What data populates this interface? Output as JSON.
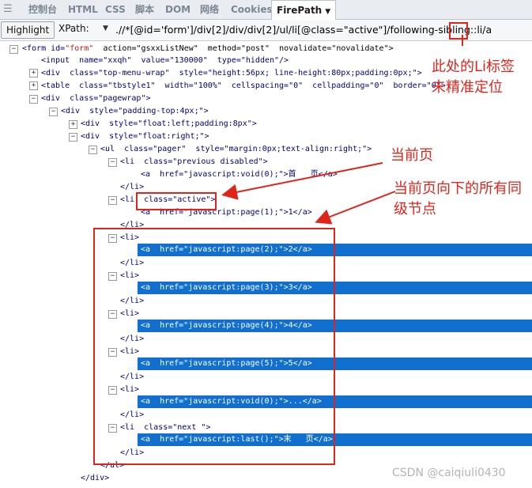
{
  "tabs": [
    {
      "label": "控制台"
    },
    {
      "label": "HTML"
    },
    {
      "label": "CSS"
    },
    {
      "label": "脚本"
    },
    {
      "label": "DOM"
    },
    {
      "label": "网络"
    },
    {
      "label": "Cookies"
    },
    {
      "label": "FirePath"
    }
  ],
  "toolbar": {
    "highlight_label": "Highlight",
    "xpath_label": "XPath:",
    "xpath_value": ".//*[@id='form']/div[2]/div/div[2]/ul/li[@class=\"active\"]/following-sibling::li/a"
  },
  "code_lines": [
    {
      "t": "<form ",
      "a": "id=",
      "v": "\"form\"",
      "rest": "  action=\"gsxxListNew\"  method=\"post\"  novalidate=\"novalidate\">"
    },
    {
      "t": "<input ",
      "rest": " name=\"xxqh\"  value=\"130000\"  type=\"hidden\"/>"
    },
    {
      "t": "<div ",
      "rest": " class=\"top-menu-wrap\"  style=\"height:56px; line-height:80px;padding:0px;\">"
    },
    {
      "t": "<table ",
      "rest": " class=\"tbstyle1\"  width=\"100%\"  cellspacing=\"0\"  cellpadding=\"0\"  border=\"0\">"
    },
    {
      "t": "<div ",
      "rest": " class=\"pagewrap\">"
    },
    {
      "t": "<div ",
      "rest": " style=\"padding-top:4px;\">"
    },
    {
      "t": "<div ",
      "rest": " style=\"float:left;padding:8px\">"
    },
    {
      "t": "<div ",
      "rest": " style=\"float:right;\">"
    },
    {
      "t": "<ul ",
      "rest": " class=\"pager\"  style=\"margin:0px;text-align:right;\">"
    },
    {
      "t": "<li ",
      "rest": " class=\"previous disabled\">"
    },
    {
      "t": "<a ",
      "rest": " href=\"javascript:void(0);\">首   页</a>"
    },
    {
      "t": "</li>",
      "rest": ""
    },
    {
      "t": "<li ",
      "rest": " class=\"active\">"
    },
    {
      "t": "<a ",
      "rest": " href=\"javascript:page(1);\">1</a>"
    },
    {
      "t": "</li>",
      "rest": ""
    },
    {
      "t": "<li>",
      "rest": ""
    },
    {
      "t": "<a ",
      "rest": " href=\"javascript:page(2);\">2</a>"
    },
    {
      "t": "</li>",
      "rest": ""
    },
    {
      "t": "<li>",
      "rest": ""
    },
    {
      "t": "<a ",
      "rest": " href=\"javascript:page(3);\">3</a>"
    },
    {
      "t": "</li>",
      "rest": ""
    },
    {
      "t": "<li>",
      "rest": ""
    },
    {
      "t": "<a ",
      "rest": " href=\"javascript:page(4);\">4</a>"
    },
    {
      "t": "</li>",
      "rest": ""
    },
    {
      "t": "<li>",
      "rest": ""
    },
    {
      "t": "<a ",
      "rest": " href=\"javascript:page(5);\">5</a>"
    },
    {
      "t": "</li>",
      "rest": ""
    },
    {
      "t": "<li>",
      "rest": ""
    },
    {
      "t": "<a ",
      "rest": " href=\"javascript:void(0);\">...</a>"
    },
    {
      "t": "</li>",
      "rest": ""
    },
    {
      "t": "<li ",
      "rest": " class=\"next \">"
    },
    {
      "t": "<a ",
      "rest": " href=\"javascript:last();\">末   页</a>"
    },
    {
      "t": "</li>",
      "rest": ""
    },
    {
      "t": "</ul>",
      "rest": ""
    },
    {
      "t": "</div>",
      "rest": ""
    }
  ],
  "annotations": {
    "li_note": "此处的Li标签未精准定位",
    "current_page": "当前页",
    "siblings_note": "当前页向下的所有同级节点"
  },
  "watermark": "CSDN @caiqiuli0430",
  "colors": {
    "highlight_bg": "#1170cf",
    "annotation_red": "#e2231a",
    "tag_blue": "#000080",
    "value_red": "#c41a16"
  }
}
